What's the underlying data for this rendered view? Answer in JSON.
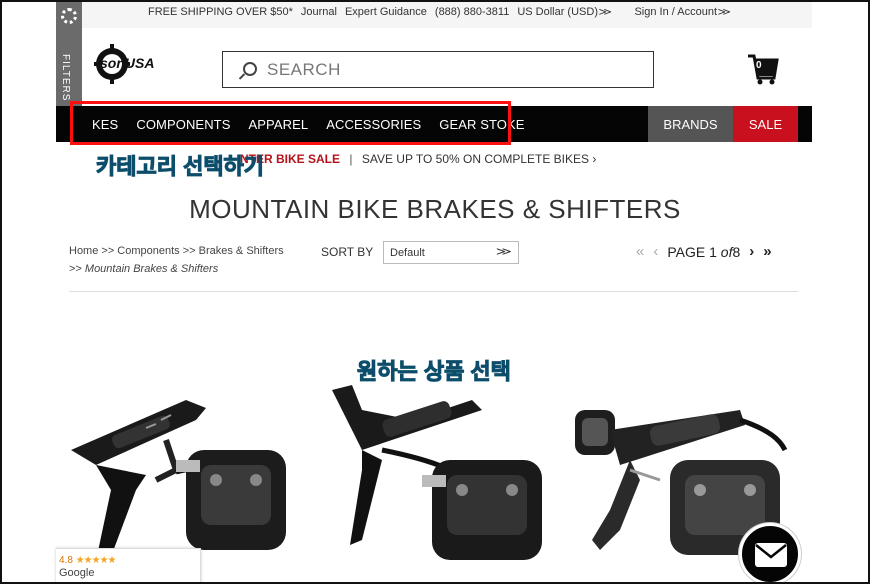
{
  "topbar": {
    "shipping": "FREE SHIPPING OVER $50*",
    "journal": "Journal",
    "expert": "Expert Guidance",
    "phone": "(888) 880-3811",
    "currency": "US Dollar (USD)",
    "account": "Sign In / Account"
  },
  "filters": {
    "label": "FILTERS"
  },
  "logo": {
    "text": "sonUSA"
  },
  "search": {
    "placeholder": "SEARCH"
  },
  "cart": {
    "count": "0"
  },
  "nav": {
    "items": [
      "KES",
      "COMPONENTS",
      "APPAREL",
      "ACCESSORIES",
      "GEAR STOKE"
    ],
    "brands": "BRANDS",
    "sale": "SALE"
  },
  "promo": {
    "red_text": "NTER BIKE SALE",
    "separator": "|",
    "text": "SAVE UP TO 50% ON COMPLETE BIKES",
    "arrow": "›"
  },
  "annotations": {
    "category": "카테고리 선택하기",
    "product": "원하는 상품 선택"
  },
  "page": {
    "title": "MOUNTAIN BIKE BRAKES & SHIFTERS"
  },
  "breadcrumb": {
    "line1": "Home >> Components >> Brakes & Shifters",
    "prefix": ">> ",
    "current": "Mountain Brakes & Shifters"
  },
  "sort": {
    "label": "SORT BY",
    "selected": "Default"
  },
  "pager": {
    "first": "«",
    "prev": "‹",
    "page_word": "PAGE",
    "current": "1",
    "of": "of",
    "total": "8",
    "next": "›",
    "last": "»"
  },
  "products": [
    {
      "image": "shimano-xt-brake-lever-caliper"
    },
    {
      "image": "shimano-slx-brake-lever-caliper"
    },
    {
      "image": "shimano-zee-brake-lever-caliper"
    }
  ],
  "rating": {
    "score": "4.8",
    "stars": "★★★★★",
    "provider": "Google"
  },
  "colors": {
    "nav_bg": "#050505",
    "sale_bg": "#c8101e",
    "brands_bg": "#555555",
    "highlight": "#ff1010",
    "annotation": "#2aa8d8"
  }
}
